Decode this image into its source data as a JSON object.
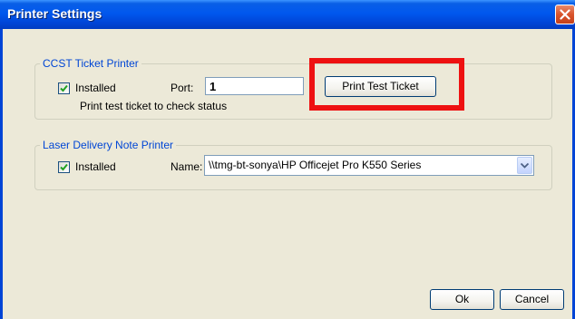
{
  "window": {
    "title": "Printer Settings",
    "close_icon": "close-icon"
  },
  "ccst_group": {
    "legend": "CCST Ticket Printer",
    "installed_label": "Installed",
    "installed_checked": true,
    "port_label": "Port:",
    "port_value": "1",
    "print_test_button": "Print Test Ticket",
    "status_hint": "Print test ticket to check status"
  },
  "laser_group": {
    "legend": "Laser Delivery Note Printer",
    "installed_label": "Installed",
    "installed_checked": true,
    "name_label": "Name:",
    "name_value": "\\\\tmg-bt-sonya\\HP Officejet Pro K550 Series"
  },
  "footer": {
    "ok_label": "Ok",
    "cancel_label": "Cancel"
  },
  "colors": {
    "title_bar": "#0058ee",
    "legend_text": "#0046d5",
    "highlight_box": "#ee1111",
    "dialog_bg": "#ece9d8"
  }
}
